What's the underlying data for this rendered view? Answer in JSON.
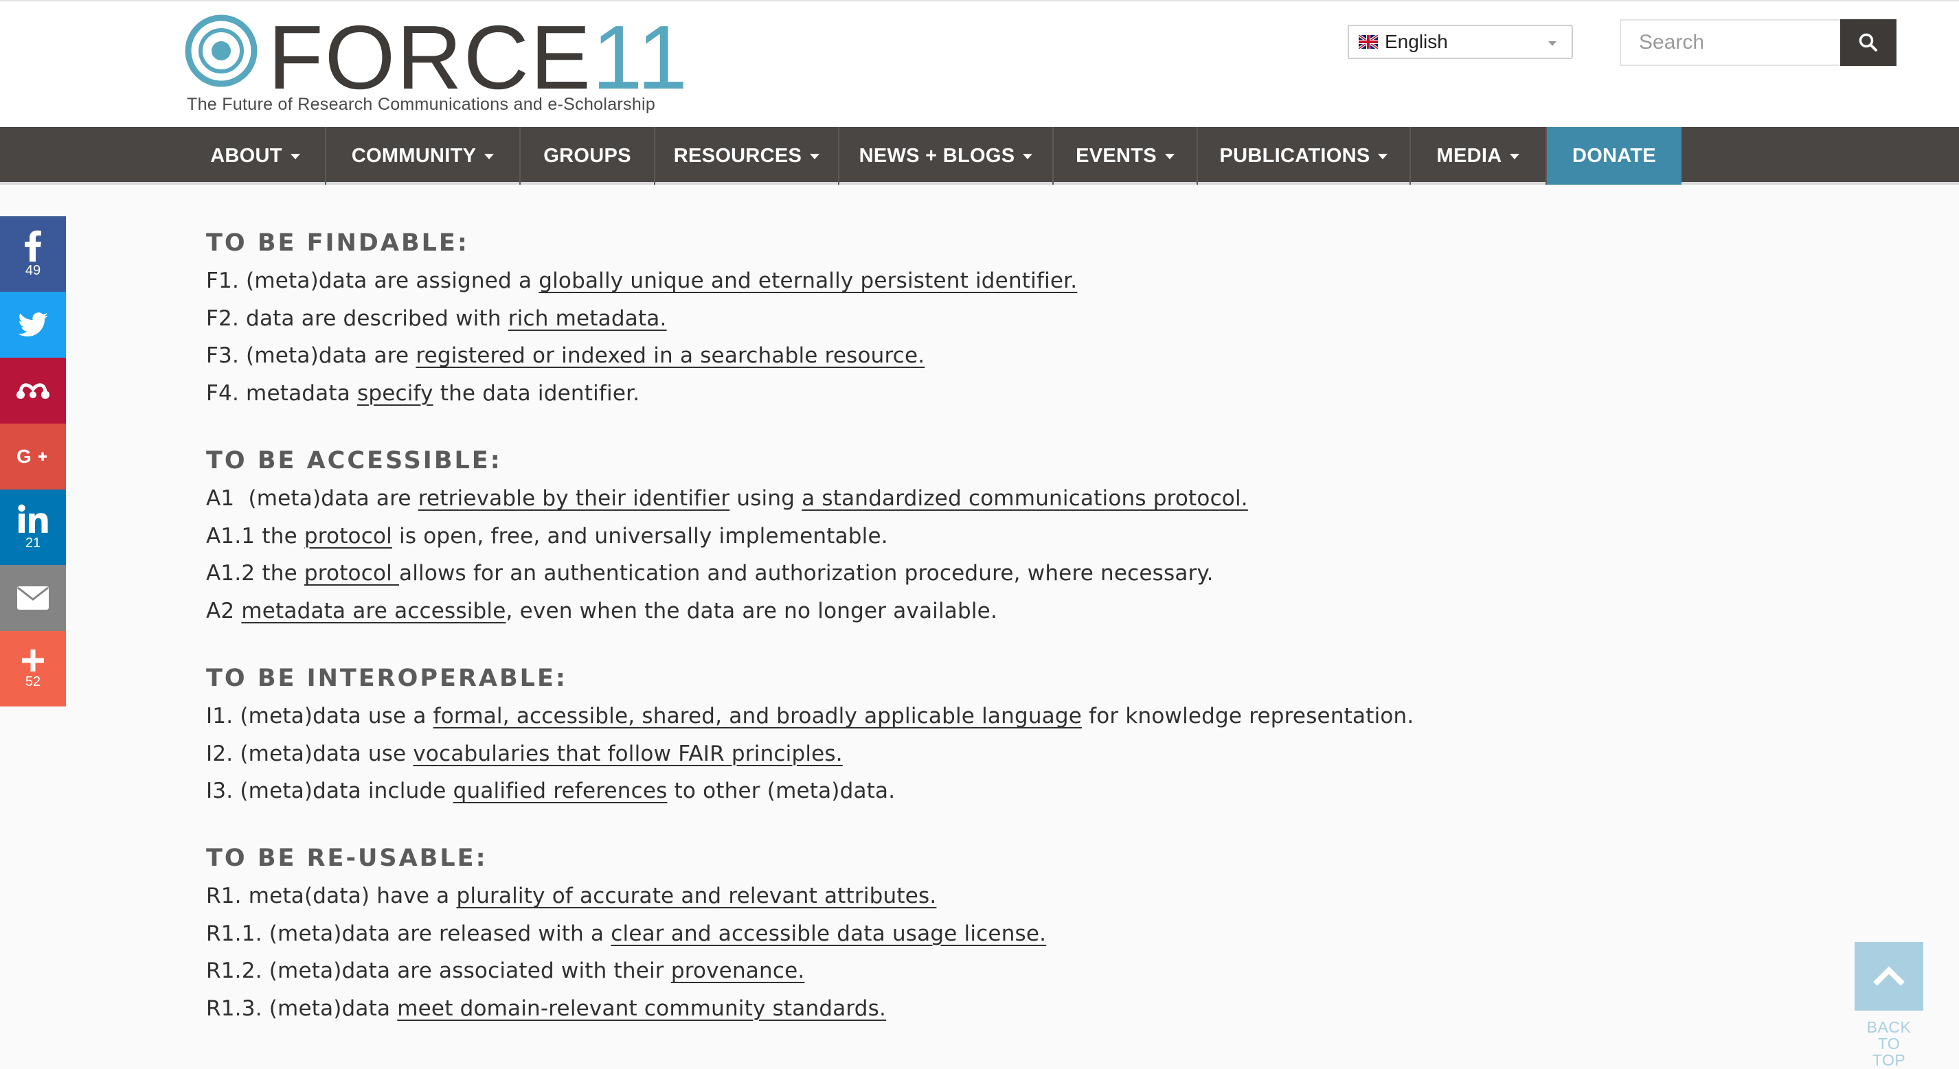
{
  "header": {
    "logo_force": "FORCE",
    "logo_eleven": "11",
    "tagline": "The Future of Research Communications and e-Scholarship",
    "language": "English",
    "search_placeholder": "Search"
  },
  "nav": {
    "items": [
      {
        "label": "ABOUT",
        "dropdown": true
      },
      {
        "label": "COMMUNITY",
        "dropdown": true
      },
      {
        "label": "GROUPS",
        "dropdown": false
      },
      {
        "label": "RESOURCES",
        "dropdown": true
      },
      {
        "label": "NEWS + BLOGS",
        "dropdown": true
      },
      {
        "label": "EVENTS",
        "dropdown": true
      },
      {
        "label": "PUBLICATIONS",
        "dropdown": true
      },
      {
        "label": "MEDIA",
        "dropdown": true
      },
      {
        "label": "DONATE",
        "dropdown": false
      }
    ]
  },
  "social": [
    {
      "name": "facebook-icon",
      "count": "49",
      "color": "#3b5998"
    },
    {
      "name": "twitter-icon",
      "count": "",
      "color": "#1da1f2"
    },
    {
      "name": "mendeley-icon",
      "count": "",
      "color": "#b7163a"
    },
    {
      "name": "google-plus-icon",
      "count": "",
      "color": "#dc4e41"
    },
    {
      "name": "linkedin-icon",
      "count": "21",
      "color": "#0077b5"
    },
    {
      "name": "email-icon",
      "count": "",
      "color": "#848484"
    },
    {
      "name": "share-plus-icon",
      "count": "52",
      "color": "#f2654c"
    }
  ],
  "sections": [
    {
      "heading": "TO BE FINDABLE:",
      "items": [
        [
          {
            "t": "F1. (meta)data are assigned a "
          },
          {
            "t": "globally unique and eternally persistent identifier.",
            "link": true
          }
        ],
        [
          {
            "t": "F2. data are described with "
          },
          {
            "t": "rich metadata.",
            "link": true
          }
        ],
        [
          {
            "t": "F3. (meta)data are "
          },
          {
            "t": "registered or indexed in a searchable resource.",
            "link": true
          }
        ],
        [
          {
            "t": "F4. metadata "
          },
          {
            "t": "specify",
            "link": true
          },
          {
            "t": " the data identifier."
          }
        ]
      ]
    },
    {
      "heading": "TO BE ACCESSIBLE:",
      "items": [
        [
          {
            "t": "A1  (meta)data are "
          },
          {
            "t": "retrievable by their identifier",
            "link": true
          },
          {
            "t": " using "
          },
          {
            "t": "a standardized communications protocol.",
            "link": true
          }
        ],
        [
          {
            "t": "A1.1 the "
          },
          {
            "t": "protocol",
            "link": true
          },
          {
            "t": " is open, free, and universally implementable."
          }
        ],
        [
          {
            "t": "A1.2 the "
          },
          {
            "t": "protocol ",
            "link": true
          },
          {
            "t": "allows for an authentication and authorization procedure, where necessary."
          }
        ],
        [
          {
            "t": "A2 "
          },
          {
            "t": "metadata are accessible",
            "link": true
          },
          {
            "t": ", even when the data are no longer available."
          }
        ]
      ]
    },
    {
      "heading": "TO BE INTEROPERABLE:",
      "items": [
        [
          {
            "t": "I1. (meta)data use a "
          },
          {
            "t": "formal, accessible, shared, and broadly applicable language",
            "link": true
          },
          {
            "t": " for knowledge representation."
          }
        ],
        [
          {
            "t": "I2. (meta)data use "
          },
          {
            "t": "vocabularies that follow FAIR principles.",
            "link": true
          }
        ],
        [
          {
            "t": "I3. (meta)data include "
          },
          {
            "t": "qualified references",
            "link": true
          },
          {
            "t": " to other (meta)data."
          }
        ]
      ]
    },
    {
      "heading": "TO BE RE-USABLE:",
      "items": [
        [
          {
            "t": "R1. meta(data) have a "
          },
          {
            "t": "plurality of accurate and relevant attributes.",
            "link": true
          }
        ],
        [
          {
            "t": "R1.1. (meta)data are released with a "
          },
          {
            "t": "clear and accessible data usage license.",
            "link": true
          }
        ],
        [
          {
            "t": "R1.2. (meta)data are associated with their "
          },
          {
            "t": "provenance.",
            "link": true
          }
        ],
        [
          {
            "t": "R1.3. (meta)data "
          },
          {
            "t": "meet domain-relevant community standards.",
            "link": true
          }
        ]
      ]
    }
  ],
  "back_to_top": {
    "line1": "BACK TO",
    "line2": "TOP"
  },
  "colors": {
    "nav_bg": "#4a4643",
    "donate_bg": "#3f8aa8",
    "logo_accent": "#57a7bf"
  }
}
